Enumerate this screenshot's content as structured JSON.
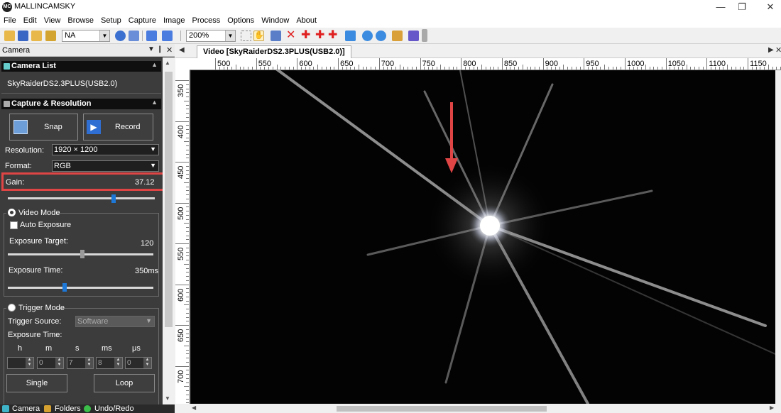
{
  "app": {
    "title": "MALLINCAMSKY",
    "logo_text": "MC"
  },
  "menu": [
    "File",
    "Edit",
    "View",
    "Browse",
    "Setup",
    "Capture",
    "Image",
    "Process",
    "Options",
    "Window",
    "About"
  ],
  "toolbar": {
    "profile_value": "NA",
    "zoom_value": "200%"
  },
  "camera_panel": {
    "title": "Camera",
    "camera_list": {
      "heading": "Camera List",
      "device": "SkyRaiderDS2.3PLUS(USB2.0)"
    },
    "capture": {
      "heading": "Capture & Resolution",
      "snap_label": "Snap",
      "record_label": "Record",
      "resolution_label": "Resolution:",
      "resolution_value": "1920 × 1200",
      "format_label": "Format:",
      "format_value": "RGB",
      "gain_label": "Gain:",
      "gain_value": "37.12",
      "gain_level": 0.72
    },
    "video_mode": {
      "label": "Video Mode",
      "auto_exposure_label": "Auto Exposure",
      "exposure_target_label": "Exposure Target:",
      "exposure_target_value": "120",
      "exposure_target_level": 0.51,
      "exposure_time_label": "Exposure Time:",
      "exposure_time_value": "350ms",
      "exposure_time_level": 0.39
    },
    "trigger_mode": {
      "label": "Trigger Mode",
      "trigger_source_label": "Trigger Source:",
      "trigger_source_value": "Software",
      "exposure_time_label": "Exposure Time:",
      "units": [
        "h",
        "m",
        "s",
        "ms",
        "μs"
      ],
      "values": [
        "",
        "0",
        "7",
        "8",
        "0"
      ],
      "single_label": "Single",
      "loop_label": "Loop"
    }
  },
  "bottom_tabs": [
    "Camera",
    "Folders",
    "Undo/Redo"
  ],
  "video": {
    "tab_label": "Video [SkyRaiderDS2.3PLUS(USB2.0)]",
    "ruler_x": [
      "500",
      "550",
      "600",
      "650",
      "700",
      "750",
      "800",
      "850",
      "900",
      "950",
      "1000",
      "1050",
      "1100",
      "1150"
    ],
    "ruler_y": [
      "350",
      "400",
      "450",
      "500",
      "550",
      "600",
      "650",
      "700"
    ]
  },
  "colors": {
    "accent_highlight": "#e04545",
    "arrow": "#e04545",
    "slider_blue": "#1e78d8"
  }
}
